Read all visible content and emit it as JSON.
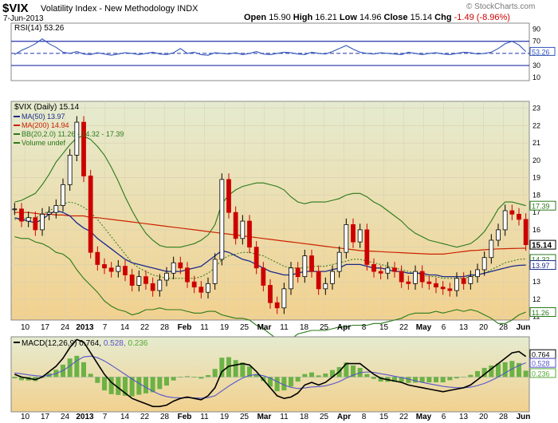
{
  "header": {
    "symbol": "$VIX",
    "description": "Volatility Index - New Methodology",
    "exchange": "INDX",
    "date": "7-Jun-2013",
    "watermark": "© StockCharts.com",
    "open_label": "Open",
    "open": "15.90",
    "high_label": "High",
    "high": "16.21",
    "low_label": "Low",
    "low": "14.96",
    "close_label": "Close",
    "close": "15.14",
    "chg_label": "Chg",
    "chg": "-1.49 (-8.96%)"
  },
  "colors": {
    "rsi_line": "#3355bb",
    "ma50": "#1a2a8a",
    "ma200": "#cc2200",
    "bb": "#2a7a1a",
    "up_candle": "#000000",
    "down_candle": "#cc0000",
    "macd_line": "#000000",
    "signal_line": "#5555cc",
    "histogram": "#55aa33",
    "panel_bg_top": "#dfe6c6",
    "panel_bg_bottom": "#f1d49a"
  },
  "chart_data": {
    "type": "candlestick",
    "x_labels": [
      "10",
      "17",
      "24",
      "2013",
      "7",
      "14",
      "22",
      "28",
      "Feb",
      "11",
      "19",
      "25",
      "Mar",
      "11",
      "18",
      "25",
      "Apr",
      "8",
      "15",
      "22",
      "May",
      "6",
      "13",
      "20",
      "28",
      "Jun"
    ],
    "rsi": {
      "label": "RSI(14) 53.26",
      "levels": [
        30,
        70
      ],
      "yticks": [
        10,
        30,
        50,
        70,
        90
      ],
      "last": 53.26,
      "values": [
        48,
        55,
        60,
        66,
        74,
        66,
        60,
        52,
        50,
        53,
        49,
        48,
        51,
        49,
        47,
        49,
        51,
        50,
        48,
        50,
        52,
        49,
        48,
        51,
        58,
        50,
        52,
        48,
        47,
        51,
        50,
        49,
        51,
        48,
        50,
        53,
        49,
        48,
        50,
        52,
        51,
        49,
        48,
        52,
        50,
        49,
        53,
        58,
        63,
        57,
        52,
        50,
        49,
        51,
        50,
        49,
        48,
        52,
        50,
        48,
        50,
        51,
        49,
        48,
        50,
        52,
        51,
        49,
        50,
        52,
        58,
        66,
        70,
        64,
        53
      ]
    },
    "price": {
      "title": "$VIX (Daily) 15.14",
      "legend": [
        {
          "name": "MA(50) 13.97"
        },
        {
          "name": "MA(200) 14.94"
        },
        {
          "name": "BB(20,2.0) 11.26 - 14.32 - 17.39"
        },
        {
          "name": "Volume undef"
        }
      ],
      "ylim": [
        10.8,
        23.4
      ],
      "yticks": [
        11,
        12,
        13,
        14,
        15,
        16,
        17,
        18,
        19,
        20,
        21,
        22,
        23
      ],
      "right_labels": [
        {
          "text": "17.39",
          "value": 17.39
        },
        {
          "text": "15.14",
          "value": 15.14
        },
        {
          "text": "14.32",
          "value": 14.32
        },
        {
          "text": "13.97",
          "value": 13.97
        },
        {
          "text": "11.26",
          "value": 11.26
        }
      ],
      "closes": [
        17.2,
        16.5,
        16.7,
        16.0,
        16.9,
        17.0,
        17.4,
        18.6,
        20.3,
        22.2,
        19.1,
        14.7,
        14.0,
        13.8,
        13.6,
        13.9,
        13.4,
        12.8,
        13.3,
        12.9,
        12.5,
        13.1,
        13.5,
        14.1,
        13.8,
        13.0,
        12.7,
        12.4,
        12.9,
        14.3,
        18.9,
        17.0,
        15.5,
        16.5,
        15.0,
        13.8,
        12.8,
        11.8,
        11.5,
        12.6,
        13.8,
        13.3,
        14.5,
        13.6,
        12.6,
        12.9,
        13.6,
        14.7,
        16.3,
        15.3,
        16.0,
        14.0,
        13.6,
        13.5,
        13.8,
        13.6,
        13.0,
        12.9,
        13.6,
        13.0,
        12.9,
        12.7,
        12.6,
        12.5,
        13.2,
        12.9,
        13.3,
        13.7,
        14.4,
        15.4,
        16.0,
        17.1,
        16.9,
        16.6,
        15.14
      ],
      "ma50": [
        16.7,
        16.6,
        16.5,
        16.4,
        16.6,
        16.9,
        17.1,
        17.0,
        16.8,
        16.4,
        16.1,
        15.9,
        15.5,
        15.2,
        14.9,
        14.6,
        14.3,
        14.1,
        14.0,
        13.9,
        13.8,
        13.7,
        13.6,
        13.6,
        13.6,
        13.7,
        13.8,
        13.9,
        14.2,
        14.5,
        14.8,
        14.7,
        14.5,
        14.3,
        14.2,
        14.0,
        13.8,
        13.6,
        13.5,
        13.4,
        13.4,
        13.5,
        13.6,
        13.6,
        13.6,
        13.6,
        13.7,
        13.8,
        14.0,
        14.0,
        14.0,
        13.9,
        13.8,
        13.8,
        13.7,
        13.6,
        13.6,
        13.5,
        13.5,
        13.5,
        13.4,
        13.4,
        13.3,
        13.3,
        13.3,
        13.3,
        13.4,
        13.4,
        13.5,
        13.6,
        13.7,
        13.8,
        13.9,
        13.95,
        13.97
      ],
      "ma200": [
        17.0,
        17.0,
        17.0,
        16.95,
        16.9,
        16.9,
        16.85,
        16.85,
        16.8,
        16.8,
        16.8,
        16.7,
        16.7,
        16.65,
        16.6,
        16.55,
        16.5,
        16.45,
        16.4,
        16.35,
        16.3,
        16.25,
        16.2,
        16.15,
        16.1,
        16.05,
        16.0,
        15.95,
        15.9,
        15.85,
        15.8,
        15.75,
        15.7,
        15.65,
        15.6,
        15.55,
        15.5,
        15.45,
        15.4,
        15.35,
        15.3,
        15.25,
        15.2,
        15.15,
        15.1,
        15.05,
        15.0,
        14.95,
        14.9,
        14.85,
        14.8,
        14.78,
        14.76,
        14.74,
        14.72,
        14.7,
        14.68,
        14.66,
        14.64,
        14.62,
        14.6,
        14.6,
        14.6,
        14.65,
        14.7,
        14.75,
        14.8,
        14.82,
        14.85,
        14.88,
        14.9,
        14.91,
        14.92,
        14.93,
        14.94
      ],
      "bb_upper": [
        17.6,
        17.7,
        17.9,
        18.1,
        18.6,
        19.2,
        19.9,
        20.4,
        20.9,
        21.3,
        21.4,
        21.2,
        20.8,
        20.3,
        19.6,
        18.8,
        17.9,
        17.1,
        16.4,
        15.8,
        15.4,
        15.1,
        15.0,
        15.0,
        15.0,
        15.1,
        15.2,
        15.4,
        15.7,
        16.3,
        17.5,
        18.0,
        18.3,
        18.5,
        18.6,
        18.7,
        18.7,
        18.6,
        18.5,
        18.3,
        17.9,
        17.6,
        17.5,
        17.6,
        17.6,
        17.6,
        17.7,
        17.8,
        18.0,
        18.1,
        18.1,
        17.9,
        17.6,
        17.4,
        17.1,
        16.8,
        16.5,
        16.1,
        15.8,
        15.6,
        15.4,
        15.3,
        15.2,
        15.1,
        15.0,
        15.1,
        15.2,
        15.5,
        15.9,
        16.5,
        17.2,
        17.6,
        17.6,
        17.5,
        17.39
      ],
      "bb_mid": [
        16.6,
        16.6,
        16.7,
        16.7,
        16.9,
        17.1,
        17.3,
        17.5,
        17.6,
        17.5,
        17.3,
        17.0,
        16.6,
        16.1,
        15.6,
        15.1,
        14.6,
        14.1,
        13.8,
        13.6,
        13.4,
        13.3,
        13.2,
        13.2,
        13.2,
        13.2,
        13.2,
        13.3,
        13.5,
        13.8,
        14.3,
        14.5,
        14.6,
        14.7,
        14.7,
        14.6,
        14.5,
        14.3,
        14.1,
        13.9,
        13.8,
        13.8,
        13.8,
        13.9,
        13.9,
        13.9,
        14.0,
        14.1,
        14.2,
        14.3,
        14.3,
        14.2,
        14.1,
        14.0,
        13.9,
        13.8,
        13.7,
        13.6,
        13.5,
        13.4,
        13.3,
        13.3,
        13.2,
        13.2,
        13.2,
        13.2,
        13.3,
        13.4,
        13.5,
        13.7,
        13.9,
        14.1,
        14.2,
        14.3,
        14.32
      ],
      "bb_lower": [
        15.6,
        15.5,
        15.5,
        15.3,
        15.2,
        15.0,
        14.7,
        14.6,
        14.3,
        13.7,
        13.2,
        12.8,
        12.4,
        11.9,
        11.6,
        11.4,
        11.3,
        11.1,
        11.2,
        11.4,
        11.4,
        11.5,
        11.4,
        11.4,
        11.4,
        11.3,
        11.2,
        11.2,
        11.3,
        11.3,
        11.1,
        11.0,
        10.9,
        10.9,
        10.8,
        10.5,
        10.3,
        10.0,
        9.7,
        9.5,
        9.7,
        10.0,
        10.1,
        10.2,
        10.2,
        10.2,
        10.3,
        10.4,
        10.4,
        10.5,
        10.5,
        10.5,
        10.6,
        10.6,
        10.7,
        10.8,
        10.9,
        11.1,
        11.2,
        11.2,
        11.2,
        11.3,
        11.2,
        11.3,
        11.4,
        11.3,
        11.4,
        11.3,
        11.1,
        10.9,
        10.6,
        10.6,
        10.8,
        11.1,
        11.26
      ]
    },
    "macd": {
      "label": "MACD(12,26,9)",
      "macd_value": "0.764",
      "signal_value": "0.528",
      "hist_value": "0.236",
      "ylim": [
        -1.3,
        1.5
      ],
      "right_labels": [
        {
          "text": "0.764",
          "value": 0.764
        },
        {
          "text": "0.528",
          "value": 0.528
        },
        {
          "text": "0.236",
          "value": 0.236
        }
      ],
      "macd": [
        0.1,
        0.0,
        -0.05,
        -0.1,
        0.0,
        0.2,
        0.4,
        0.7,
        1.1,
        1.4,
        1.3,
        0.9,
        0.5,
        0.1,
        -0.2,
        -0.4,
        -0.6,
        -0.8,
        -0.9,
        -1.0,
        -1.1,
        -1.1,
        -1.05,
        -0.9,
        -0.8,
        -0.75,
        -0.8,
        -0.85,
        -0.7,
        -0.4,
        0.2,
        0.4,
        0.45,
        0.5,
        0.45,
        0.2,
        -0.1,
        -0.4,
        -0.7,
        -0.8,
        -0.75,
        -0.6,
        -0.3,
        -0.2,
        -0.3,
        -0.2,
        0.0,
        0.2,
        0.5,
        0.5,
        0.5,
        0.3,
        0.1,
        -0.05,
        -0.1,
        -0.15,
        -0.2,
        -0.3,
        -0.35,
        -0.4,
        -0.45,
        -0.5,
        -0.55,
        -0.5,
        -0.45,
        -0.4,
        -0.3,
        -0.1,
        0.1,
        0.3,
        0.5,
        0.7,
        0.9,
        0.95,
        0.764
      ],
      "signal": [
        0.15,
        0.12,
        0.08,
        0.05,
        0.03,
        0.06,
        0.13,
        0.24,
        0.41,
        0.61,
        0.75,
        0.78,
        0.72,
        0.6,
        0.44,
        0.27,
        0.1,
        -0.08,
        -0.24,
        -0.39,
        -0.53,
        -0.65,
        -0.73,
        -0.77,
        -0.78,
        -0.78,
        -0.78,
        -0.79,
        -0.77,
        -0.7,
        -0.52,
        -0.34,
        -0.18,
        -0.04,
        0.06,
        0.09,
        0.05,
        -0.04,
        -0.17,
        -0.3,
        -0.39,
        -0.43,
        -0.41,
        -0.37,
        -0.36,
        -0.33,
        -0.26,
        -0.17,
        -0.04,
        0.07,
        0.16,
        0.19,
        0.17,
        0.12,
        0.08,
        0.03,
        -0.02,
        -0.08,
        -0.14,
        -0.2,
        -0.25,
        -0.3,
        -0.35,
        -0.38,
        -0.4,
        -0.4,
        -0.38,
        -0.32,
        -0.24,
        -0.13,
        0.0,
        0.15,
        0.3,
        0.43,
        0.528
      ]
    }
  }
}
